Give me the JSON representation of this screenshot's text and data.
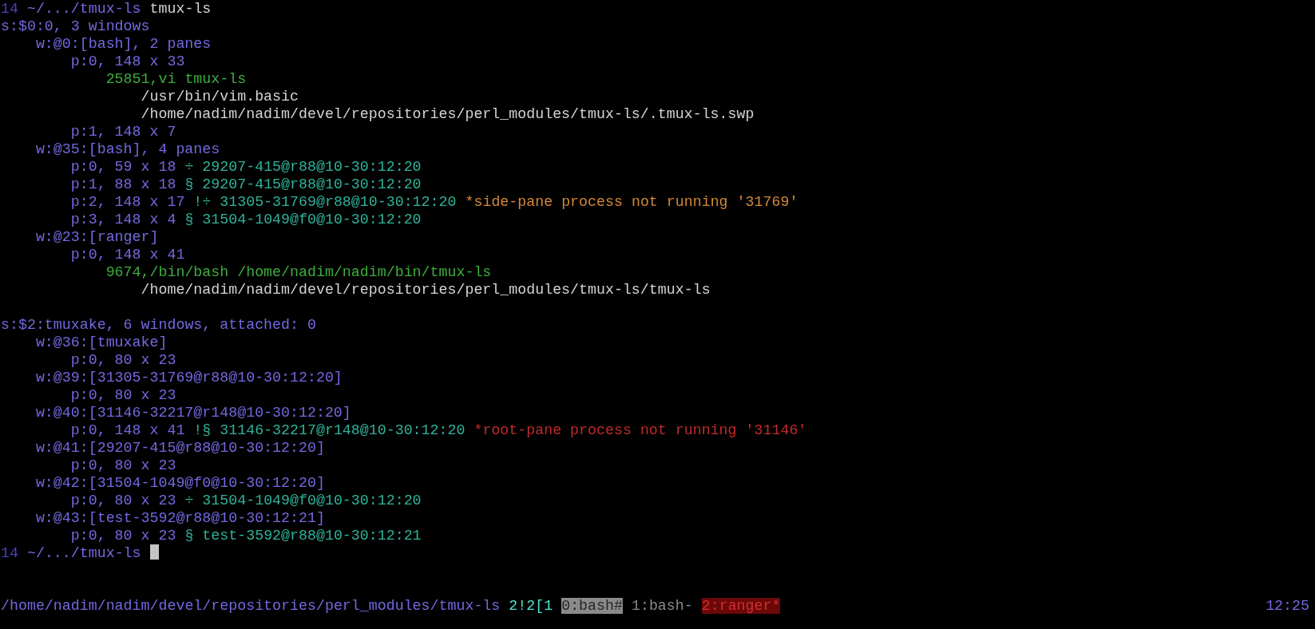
{
  "prompt": {
    "number": "14",
    "path": "~/.../tmux-ls",
    "command": "tmux-ls"
  },
  "sessions": [
    {
      "segments": [
        {
          "kind": "header",
          "text": "s:$0:0, 3 windows"
        }
      ],
      "children": [
        {
          "segments": [
            {
              "kind": "header",
              "text": "w:@0:[bash], 2 panes"
            }
          ],
          "children": [
            {
              "segments": [
                {
                  "kind": "header",
                  "text": "p:0, 148 x 33"
                }
              ],
              "children": [
                {
                  "segments": [
                    {
                      "kind": "process",
                      "text": "25851,vi tmux-ls"
                    }
                  ],
                  "children": [
                    {
                      "segments": [
                        {
                          "kind": "file",
                          "text": "/usr/bin/vim.basic"
                        }
                      ]
                    },
                    {
                      "segments": [
                        {
                          "kind": "file",
                          "text": "/home/nadim/nadim/devel/repositories/perl_modules/tmux-ls/.tmux-ls.swp"
                        }
                      ]
                    }
                  ]
                }
              ]
            },
            {
              "segments": [
                {
                  "kind": "header",
                  "text": "p:1, 148 x 7"
                }
              ]
            }
          ]
        },
        {
          "segments": [
            {
              "kind": "header",
              "text": "w:@35:[bash], 4 panes"
            }
          ],
          "children": [
            {
              "segments": [
                {
                  "kind": "header",
                  "text": "p:0, 59 x 18"
                },
                {
                  "kind": "tag",
                  "text": "÷ 29207-415@r88@10-30:12:20"
                }
              ]
            },
            {
              "segments": [
                {
                  "kind": "header",
                  "text": "p:1, 88 x 18"
                },
                {
                  "kind": "tag",
                  "text": "§ 29207-415@r88@10-30:12:20"
                }
              ]
            },
            {
              "segments": [
                {
                  "kind": "header",
                  "text": "p:2, 148 x 17"
                },
                {
                  "kind": "tag",
                  "text": "!÷ 31305-31769@r88@10-30:12:20"
                },
                {
                  "kind": "warning",
                  "text": "*side-pane process not running '31769'"
                }
              ]
            },
            {
              "segments": [
                {
                  "kind": "header",
                  "text": "p:3, 148 x 4"
                },
                {
                  "kind": "tag",
                  "text": "§ 31504-1049@f0@10-30:12:20"
                }
              ]
            }
          ]
        },
        {
          "segments": [
            {
              "kind": "header",
              "text": "w:@23:[ranger]"
            }
          ],
          "children": [
            {
              "segments": [
                {
                  "kind": "header",
                  "text": "p:0, 148 x 41"
                }
              ],
              "children": [
                {
                  "segments": [
                    {
                      "kind": "process",
                      "text": "9674,/bin/bash /home/nadim/nadim/bin/tmux-ls"
                    }
                  ],
                  "children": [
                    {
                      "segments": [
                        {
                          "kind": "file",
                          "text": "/home/nadim/nadim/devel/repositories/perl_modules/tmux-ls/tmux-ls"
                        }
                      ]
                    }
                  ]
                }
              ]
            }
          ]
        }
      ]
    },
    {
      "segments": [
        {
          "kind": "header",
          "text": "s:$2:tmuxake, 6 windows, attached: 0"
        }
      ],
      "children": [
        {
          "segments": [
            {
              "kind": "header",
              "text": "w:@36:[tmuxake]"
            }
          ],
          "children": [
            {
              "segments": [
                {
                  "kind": "header",
                  "text": "p:0, 80 x 23"
                }
              ]
            }
          ]
        },
        {
          "segments": [
            {
              "kind": "header",
              "text": "w:@39:[31305-31769@r88@10-30:12:20]"
            }
          ],
          "children": [
            {
              "segments": [
                {
                  "kind": "header",
                  "text": "p:0, 80 x 23"
                }
              ]
            }
          ]
        },
        {
          "segments": [
            {
              "kind": "header",
              "text": "w:@40:[31146-32217@r148@10-30:12:20]"
            }
          ],
          "children": [
            {
              "segments": [
                {
                  "kind": "header",
                  "text": "p:0, 148 x 41"
                },
                {
                  "kind": "tag",
                  "text": "!§ 31146-32217@r148@10-30:12:20"
                },
                {
                  "kind": "error",
                  "text": "*root-pane process not running '31146'"
                }
              ]
            }
          ]
        },
        {
          "segments": [
            {
              "kind": "header",
              "text": "w:@41:[29207-415@r88@10-30:12:20]"
            }
          ],
          "children": [
            {
              "segments": [
                {
                  "kind": "header",
                  "text": "p:0, 80 x 23"
                }
              ]
            }
          ]
        },
        {
          "segments": [
            {
              "kind": "header",
              "text": "w:@42:[31504-1049@f0@10-30:12:20]"
            }
          ],
          "children": [
            {
              "segments": [
                {
                  "kind": "header",
                  "text": "p:0, 80 x 23"
                },
                {
                  "kind": "tag",
                  "text": "÷ 31504-1049@f0@10-30:12:20"
                }
              ]
            }
          ]
        },
        {
          "segments": [
            {
              "kind": "header",
              "text": "w:@43:[test-3592@r88@10-30:12:21]"
            }
          ],
          "children": [
            {
              "segments": [
                {
                  "kind": "header",
                  "text": "p:0, 80 x 23"
                },
                {
                  "kind": "tag",
                  "text": "§ test-3592@r88@10-30:12:21"
                }
              ]
            }
          ]
        }
      ]
    }
  ],
  "prompt_after": {
    "number": "14",
    "path": "~/.../tmux-ls",
    "cursor": true
  },
  "status_bar": {
    "path": "/home/nadim/nadim/devel/repositories/perl_modules/tmux-ls",
    "session_info": "2!2[1",
    "windows": [
      {
        "label": "0:bash#",
        "kind": "current"
      },
      {
        "label": "1:bash-",
        "kind": "last"
      },
      {
        "label": "2:ranger*",
        "kind": "alert"
      }
    ],
    "time": "12:25"
  }
}
